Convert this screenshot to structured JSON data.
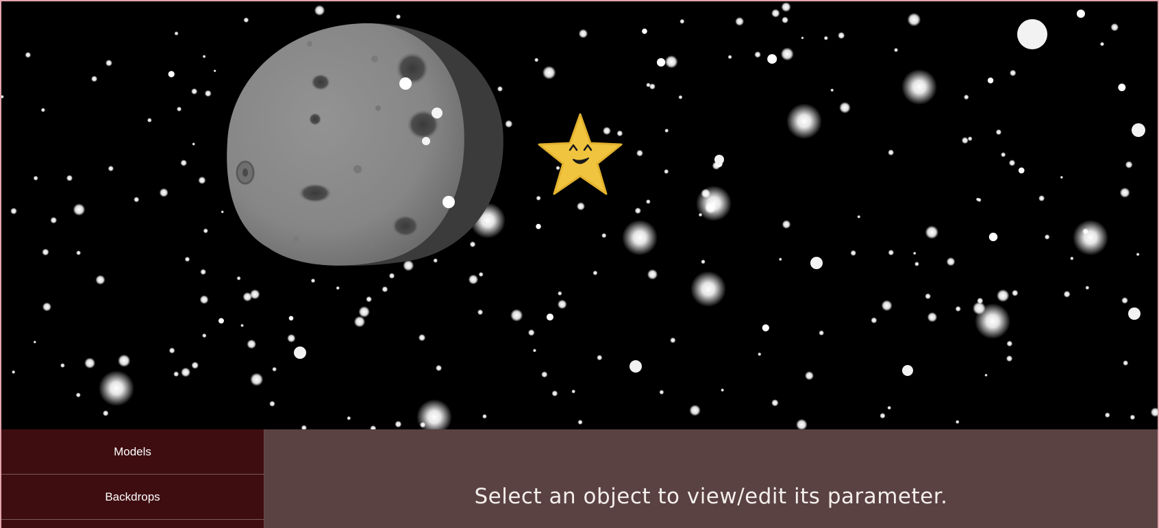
{
  "scene": {
    "backdrop": "starfield",
    "objects": [
      {
        "kind": "moon",
        "icon": "moon-icon",
        "color": "#8c8c8c"
      },
      {
        "kind": "star",
        "icon": "smiling-star-icon",
        "color": "#f1c43f"
      }
    ]
  },
  "sidebar": {
    "items": [
      {
        "label": "Models"
      },
      {
        "label": "Backdrops"
      },
      {
        "label": ""
      }
    ]
  },
  "parameters": {
    "message": "Select an object to view/edit its parameter."
  },
  "colors": {
    "sidebar_bg": "#3e0d10",
    "panel_bg": "#5a4142",
    "border_accent": "#e3a5ac"
  }
}
